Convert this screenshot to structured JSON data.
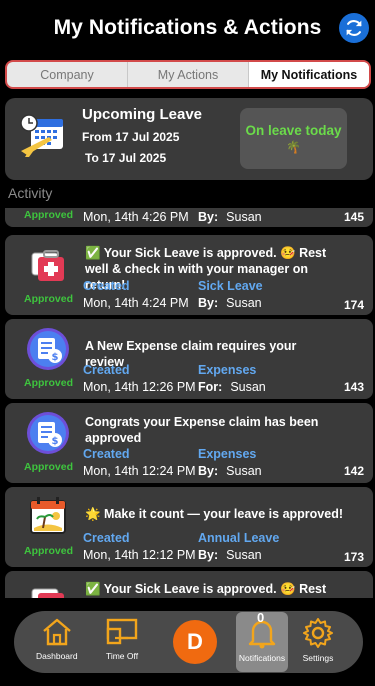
{
  "header": {
    "title": "My Notifications & Actions",
    "refresh_icon": "refresh-icon",
    "accent": "#1a6fd8"
  },
  "tabs": [
    {
      "label": "Company",
      "active": false
    },
    {
      "label": "My Actions",
      "active": false
    },
    {
      "label": "My Notifications",
      "active": true
    }
  ],
  "leave": {
    "title": "Upcoming Leave",
    "from": "From 17 Jul 2025",
    "to": "To 17 Jul 2025",
    "badge": "On leave today",
    "badge_emoji": "🌴",
    "icon": "calendar-airplane-icon"
  },
  "activity_label": "Activity",
  "partial_top": {
    "status": "Approved",
    "date": "Mon, 14th 4:26 PM",
    "by_label": "By:",
    "by_name": "Susan",
    "id": "145"
  },
  "notifications": [
    {
      "icon": "medical-kit-icon",
      "message": "✅ Your Sick Leave is approved. 🤒 Rest well & check in with your manager on return!",
      "status": "Approved",
      "created_label": "Created",
      "date": "Mon, 14th 4:24 PM",
      "type": "Sick Leave",
      "rel_label": "By:",
      "person": "Susan",
      "id": "174"
    },
    {
      "icon": "expense-receipt-icon",
      "message": "A New Expense claim requires your review",
      "status": "Approved",
      "created_label": "Created",
      "date": "Mon, 14th 12:26 PM",
      "type": "Expenses",
      "rel_label": "For:",
      "person": "Susan",
      "id": "143"
    },
    {
      "icon": "expense-receipt-icon",
      "message": "Congrats your Expense claim has been approved",
      "status": "Approved",
      "created_label": "Created",
      "date": "Mon, 14th 12:24 PM",
      "type": "Expenses",
      "rel_label": "By:",
      "person": "Susan",
      "id": "142"
    },
    {
      "icon": "beach-calendar-icon",
      "message": "🌟 Make it count — your leave is approved!",
      "status": "Approved",
      "created_label": "Created",
      "date": "Mon, 14th 12:12 PM",
      "type": "Annual Leave",
      "rel_label": "By:",
      "person": "Susan",
      "id": "173"
    },
    {
      "icon": "medical-kit-icon",
      "message": "✅ Your Sick Leave is approved. 🤒 Rest well"
    }
  ],
  "nav": {
    "dashboard": "Dashboard",
    "timeoff": "Time Off",
    "avatar_letter": "D",
    "notifications": "Notifications",
    "notif_count": "0",
    "settings": "Settings",
    "icon_color": "#f2a51c"
  }
}
